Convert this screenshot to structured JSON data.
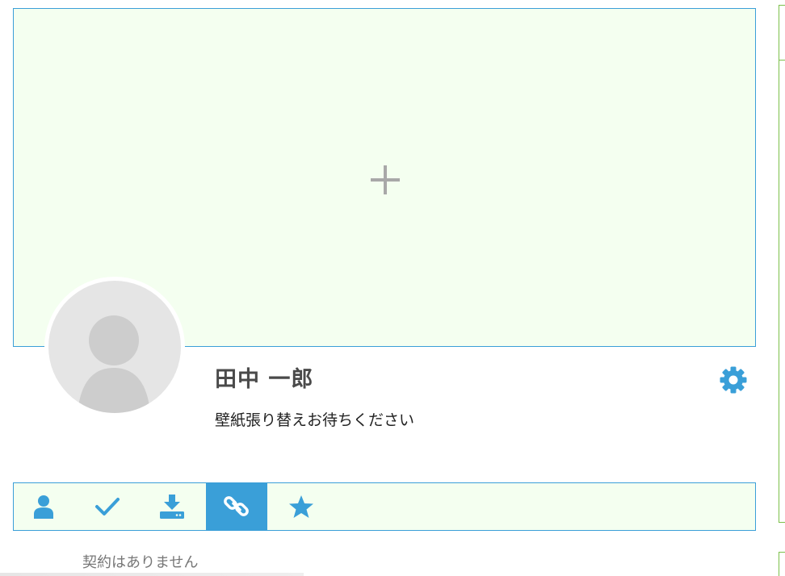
{
  "profile": {
    "name": "田中 一郎",
    "status_message": "壁紙張り替えお待ちください"
  },
  "cover": {
    "add_icon": "plus-icon"
  },
  "settings": {
    "icon": "gear-icon"
  },
  "tabs": [
    {
      "icon": "user-icon",
      "active": false
    },
    {
      "icon": "check-icon",
      "active": false
    },
    {
      "icon": "download-icon",
      "active": false
    },
    {
      "icon": "link-icon",
      "active": true
    },
    {
      "icon": "star-icon",
      "active": false
    }
  ],
  "content": {
    "empty_message": "契約はありません"
  },
  "colors": {
    "accent": "#3a9fd8",
    "panel_background": "#f4fff0",
    "icon_gray": "#a8a8a8",
    "side_border": "#7cc04a"
  }
}
